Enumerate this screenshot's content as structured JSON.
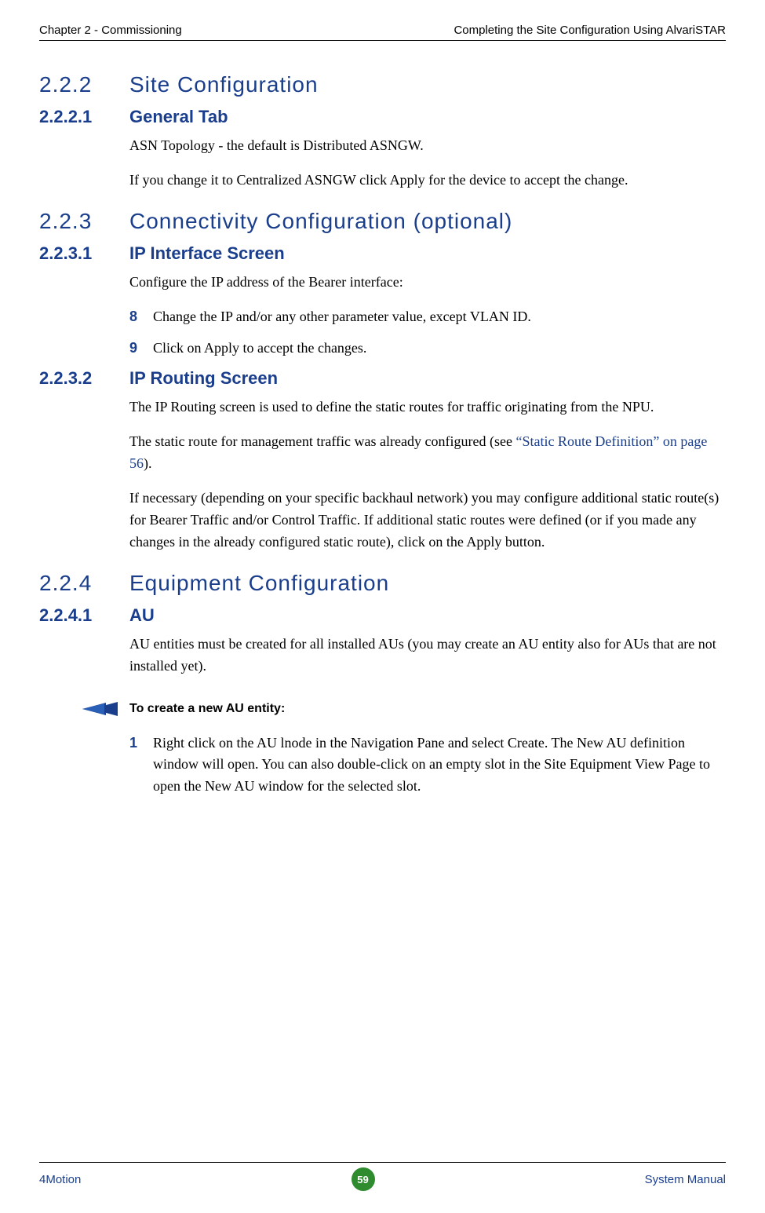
{
  "header": {
    "left": "Chapter 2 - Commissioning",
    "right": "Completing the Site Configuration Using AlvariSTAR"
  },
  "sections": {
    "s222": {
      "num": "2.2.2",
      "title": "Site Configuration"
    },
    "s2221": {
      "num": "2.2.2.1",
      "title": "General Tab",
      "p1": "ASN Topology - the default is Distributed ASNGW.",
      "p2": "If you change it to Centralized ASNGW click Apply for the device to accept the change."
    },
    "s223": {
      "num": "2.2.3",
      "title": "Connectivity Configuration (optional)"
    },
    "s2231": {
      "num": "2.2.3.1",
      "title": "IP Interface Screen",
      "p1": "Configure the IP address of the Bearer interface:",
      "step8num": "8",
      "step8": "Change the IP and/or any other parameter value, except VLAN ID.",
      "step9num": "9",
      "step9": "Click on Apply to accept the changes."
    },
    "s2232": {
      "num": "2.2.3.2",
      "title": "IP Routing Screen",
      "p1": "The IP Routing screen is used to define the static routes for traffic originating from the NPU.",
      "p2a": "The static route for management traffic was already configured (see ",
      "p2link": "“Static Route Definition” on page 56",
      "p2b": ").",
      "p3": "If necessary (depending on your specific backhaul network) you may configure additional static route(s) for Bearer Traffic and/or Control Traffic. If additional static routes were defined (or if you made any changes in the already configured static route), click on the Apply button."
    },
    "s224": {
      "num": "2.2.4",
      "title": "Equipment Configuration"
    },
    "s2241": {
      "num": "2.2.4.1",
      "title": "AU",
      "p1": "AU entities must be created for all installed AUs (you may create an AU entity also for AUs that are not installed yet).",
      "note": "To create a new AU entity:",
      "step1num": "1",
      "step1": "Right click on the AU lnode in the Navigation Pane and select Create. The New AU definition window will open. You can also double-click on an empty slot in the Site Equipment View Page to open the New AU window for the selected slot."
    }
  },
  "footer": {
    "left": "4Motion",
    "page": "59",
    "right": "System Manual"
  }
}
